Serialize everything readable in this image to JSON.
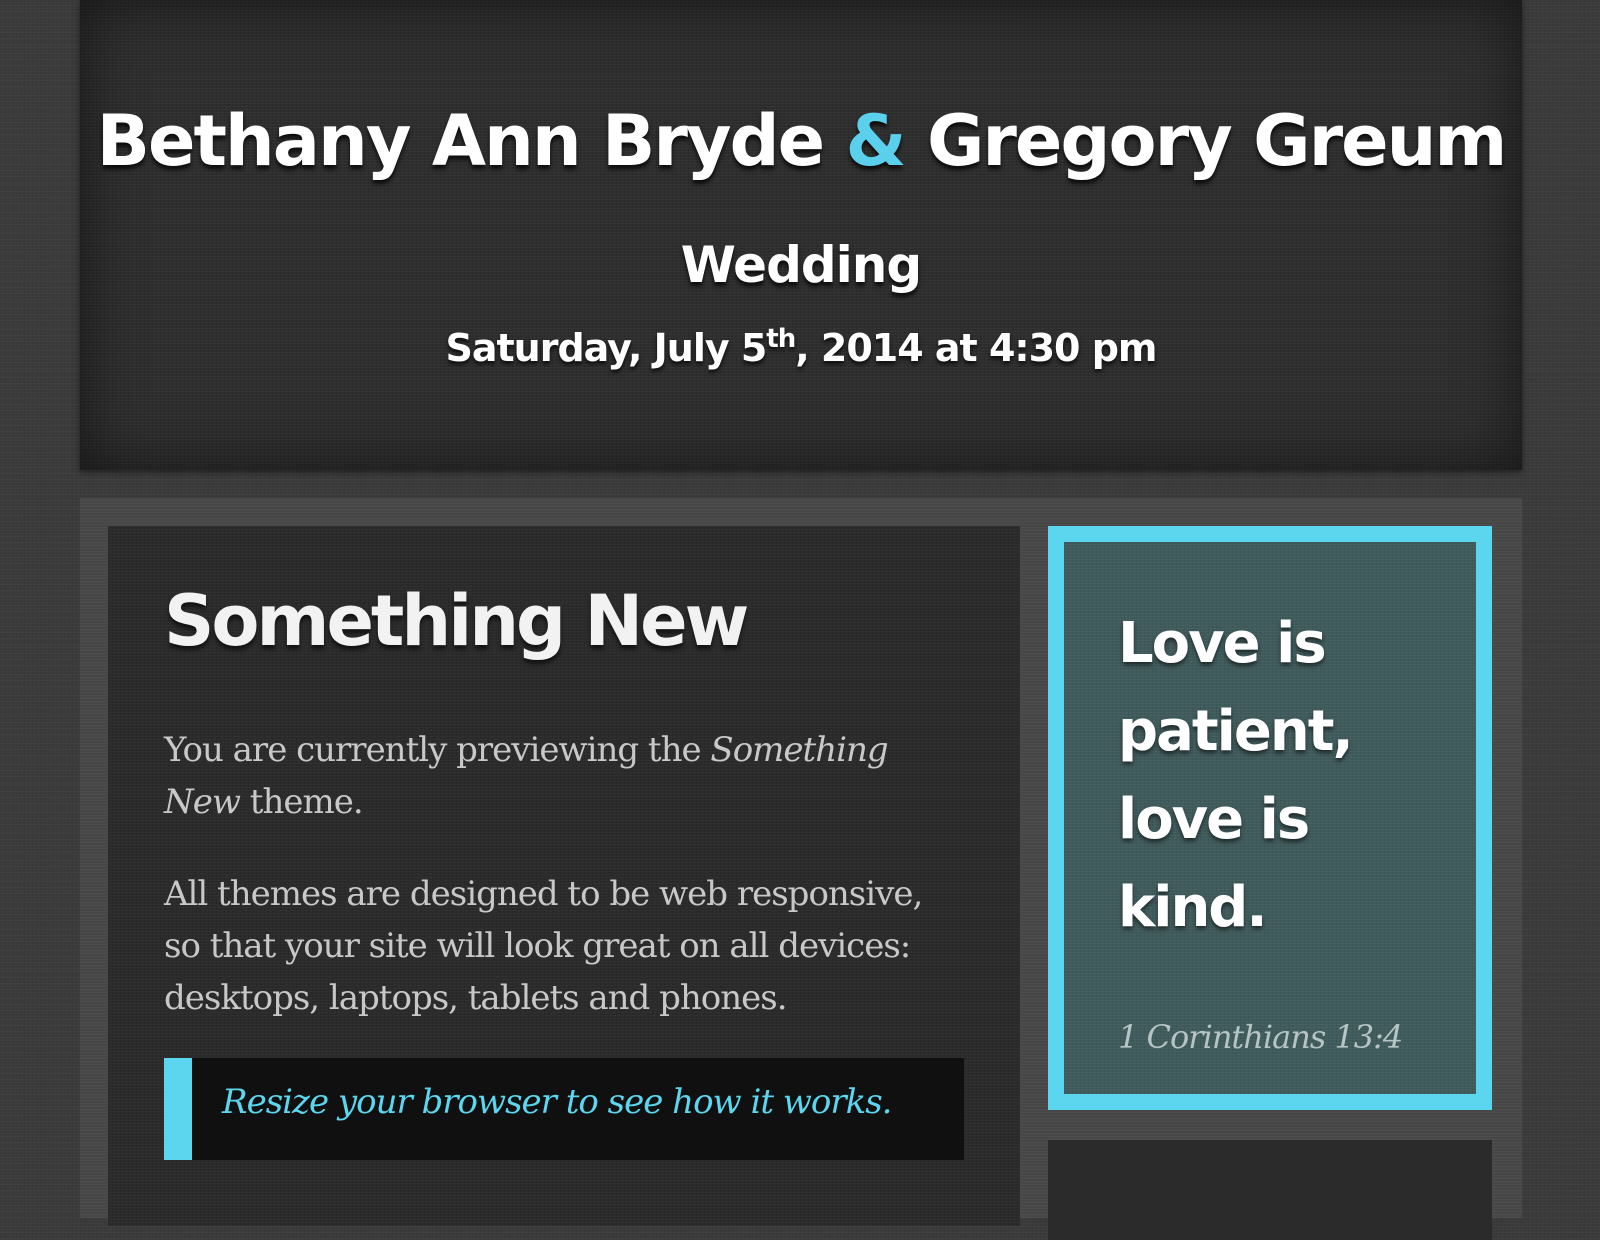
{
  "header": {
    "name_one": "Bethany Ann Bryde",
    "ampersand": "&",
    "name_two": "Gregory Greum",
    "event": "Wedding",
    "date_weekday_month": "Saturday, July 5",
    "date_suffix": "th",
    "date_rest": ", 2014 at 4:30 pm"
  },
  "main": {
    "heading": "Something New",
    "p1_before": "You are currently previewing the ",
    "p1_theme": "Something New",
    "p1_after": " theme.",
    "p2": "All themes are designed to be web responsive, so that your site will look great on all devices: desktops, laptops, tablets and phones.",
    "callout": "Resize your browser to see how it works."
  },
  "sidebar": {
    "quote": "Love is patient, love is kind.",
    "citation": "1 Corinthians 13:4"
  },
  "colors": {
    "accent": "#5bd6ee",
    "quote_background": "#405b5c",
    "page_background": "#3a3a3a"
  }
}
